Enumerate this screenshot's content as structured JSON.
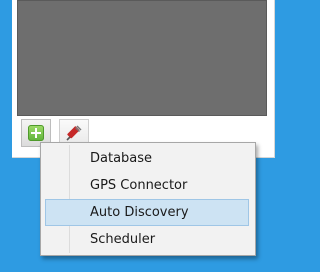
{
  "toolbar": {
    "buttons": [
      {
        "icon": "add-icon",
        "color": "#5fb23a"
      },
      {
        "icon": "plugin-icon",
        "color": "#c62828"
      }
    ]
  },
  "context_menu": {
    "items": [
      {
        "label": "Database"
      },
      {
        "label": "GPS Connector"
      },
      {
        "label": "Auto Discovery",
        "highlighted": true
      },
      {
        "label": "Scheduler"
      }
    ],
    "highlight_color": "#cde3f3"
  },
  "colors": {
    "desktop": "#2e9be2",
    "content_area": "#6e6e6e"
  }
}
